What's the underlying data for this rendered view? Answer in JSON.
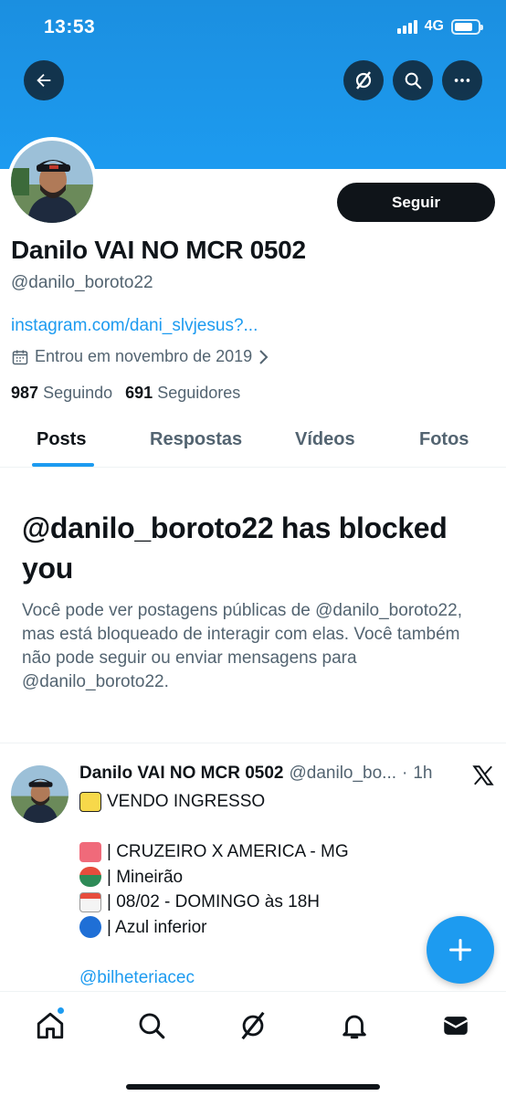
{
  "status_bar": {
    "time": "13:53",
    "network": "4G"
  },
  "colors": {
    "accent": "#1d9bf0",
    "text": "#0f1419",
    "muted": "#536471",
    "banner": "#1d9bf0"
  },
  "header": {
    "icons": [
      "back-arrow-icon",
      "grok-icon",
      "search-icon",
      "more-icon"
    ]
  },
  "profile": {
    "follow_label": "Seguir",
    "display_name": "Danilo VAI NO MCR 0502",
    "handle": "@danilo_boroto22",
    "link": "instagram.com/dani_slvjesus?...",
    "joined": "Entrou em novembro de 2019",
    "following_count": "987",
    "following_label": "Seguindo",
    "followers_count": "691",
    "followers_label": "Seguidores"
  },
  "tabs": [
    {
      "label": "Posts",
      "active": true
    },
    {
      "label": "Respostas",
      "active": false
    },
    {
      "label": "Vídeos",
      "active": false
    },
    {
      "label": "Fotos",
      "active": false
    }
  ],
  "blocked": {
    "title": "@danilo_boroto22 has blocked you",
    "description": "Você pode ver postagens públicas de @danilo_boroto22, mas está bloqueado de interagir com elas. Você também não pode seguir ou enviar mensagens para @danilo_boroto22."
  },
  "post": {
    "name": "Danilo VAI NO MCR 0502",
    "handle": "@danilo_bo...",
    "separator": "·",
    "time": "1h",
    "lines": [
      {
        "emoji": "ticket-emoji",
        "text": "VENDO INGRESSO"
      },
      {
        "emoji": "",
        "text": ""
      },
      {
        "emoji": "admit-one-ticket-emoji",
        "text": "| CRUZEIRO X AMERICA - MG"
      },
      {
        "emoji": "stadium-emoji",
        "text": "| Mineirão"
      },
      {
        "emoji": "calendar-emoji",
        "text": "| 08/02 - DOMINGO às 18H"
      },
      {
        "emoji": "blue-circle-emoji",
        "text": "| Azul inferior"
      },
      {
        "emoji": "",
        "text": ""
      }
    ],
    "mention": "@bilheteriacec"
  },
  "bottom_nav": [
    "home-icon",
    "search-icon",
    "grok-icon",
    "notifications-icon",
    "messages-icon"
  ]
}
